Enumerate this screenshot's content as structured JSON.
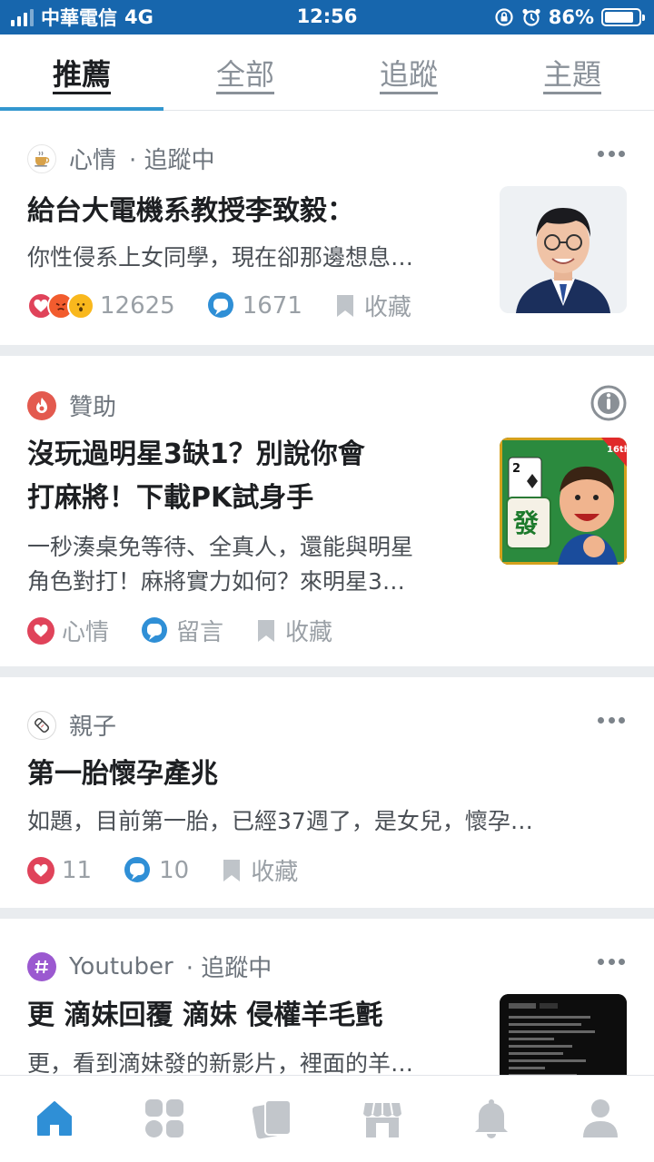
{
  "status_bar": {
    "carrier": "中華電信",
    "network": "4G",
    "time": "12:56",
    "battery_percent": "86%",
    "battery_level": 0.86
  },
  "tabs": [
    {
      "label": "推薦",
      "active": true
    },
    {
      "label": "全部",
      "active": false
    },
    {
      "label": "追蹤",
      "active": false
    },
    {
      "label": "主題",
      "active": false
    }
  ],
  "posts": [
    {
      "category": "心情",
      "follow_status": "· 追蹤中",
      "title": "給台大電機系教授李致毅：",
      "excerpt": "你性侵系上女同學，現在卻那邊想息…",
      "reactions": "12625",
      "comments": "1671",
      "save_label": "收藏"
    },
    {
      "category": "贊助",
      "title_line1": "沒玩過明星3缺1？別說你會",
      "title_line2": "打麻將！下載PK試身手",
      "excerpt_line1": "一秒湊桌免等待、全真人，還能與明星",
      "excerpt_line2": "角色對打！麻將實力如何？來明星3…",
      "reaction_label": "心情",
      "comment_label": "留言",
      "save_label": "收藏",
      "thumb_badge": "16th",
      "thumb_tile": "發",
      "thumb_card": "2"
    },
    {
      "category": "親子",
      "title": "第一胎懷孕產兆",
      "excerpt": "如題，目前第一胎，已經37週了，是女兒，懷孕…",
      "reactions": "11",
      "comments": "10",
      "save_label": "收藏"
    },
    {
      "category": "Youtuber",
      "follow_status": "· 追蹤中",
      "title": "更 滴妹回覆 滴妹 侵權羊毛氈",
      "excerpt": "更，看到滴妹發的新影片，裡面的羊…"
    }
  ],
  "colors": {
    "status_bar": "#1766ad",
    "accent": "#3397cf",
    "heart": "#e0435a",
    "comment": "#2f8fd6"
  },
  "bottom_nav": [
    {
      "icon": "home-icon",
      "active": true
    },
    {
      "icon": "boards-icon",
      "active": false
    },
    {
      "icon": "cards-icon",
      "active": false
    },
    {
      "icon": "shop-icon",
      "active": false
    },
    {
      "icon": "bell-icon",
      "active": false
    },
    {
      "icon": "profile-icon",
      "active": false
    }
  ]
}
